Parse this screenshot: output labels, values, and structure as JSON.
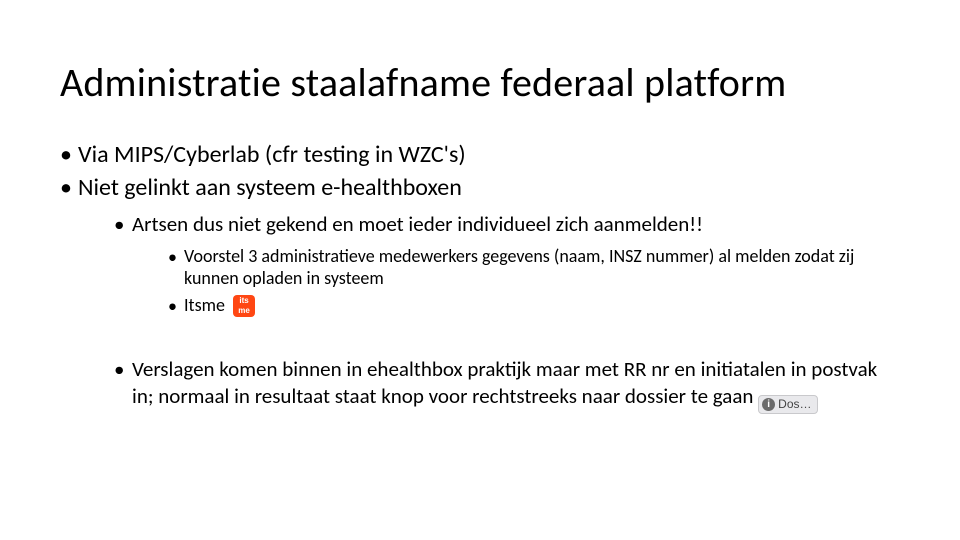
{
  "title": "Administratie staalafname federaal platform",
  "bullets": {
    "l1_0": "Via MIPS/Cyberlab (cfr testing in WZC's)",
    "l1_1": "Niet gelinkt aan systeem e-healthboxen",
    "l2_0": "Artsen dus niet gekend en moet ieder individueel zich aanmelden!!",
    "l3_0": "Voorstel 3 administratieve medewerkers gegevens (naam, INSZ nummer) al melden zodat zij kunnen opladen in systeem",
    "l3_1": "Itsme",
    "l2_1": "Verslagen komen binnen in ehealthbox praktijk maar met RR nr en initiatalen in postvak in; normaal in resultaat staat knop voor rechtstreeks naar dossier te gaan"
  },
  "icons": {
    "itsme_top": "its",
    "itsme_bottom": "me",
    "dossier_info": "i",
    "dossier_label": "Dos…"
  }
}
